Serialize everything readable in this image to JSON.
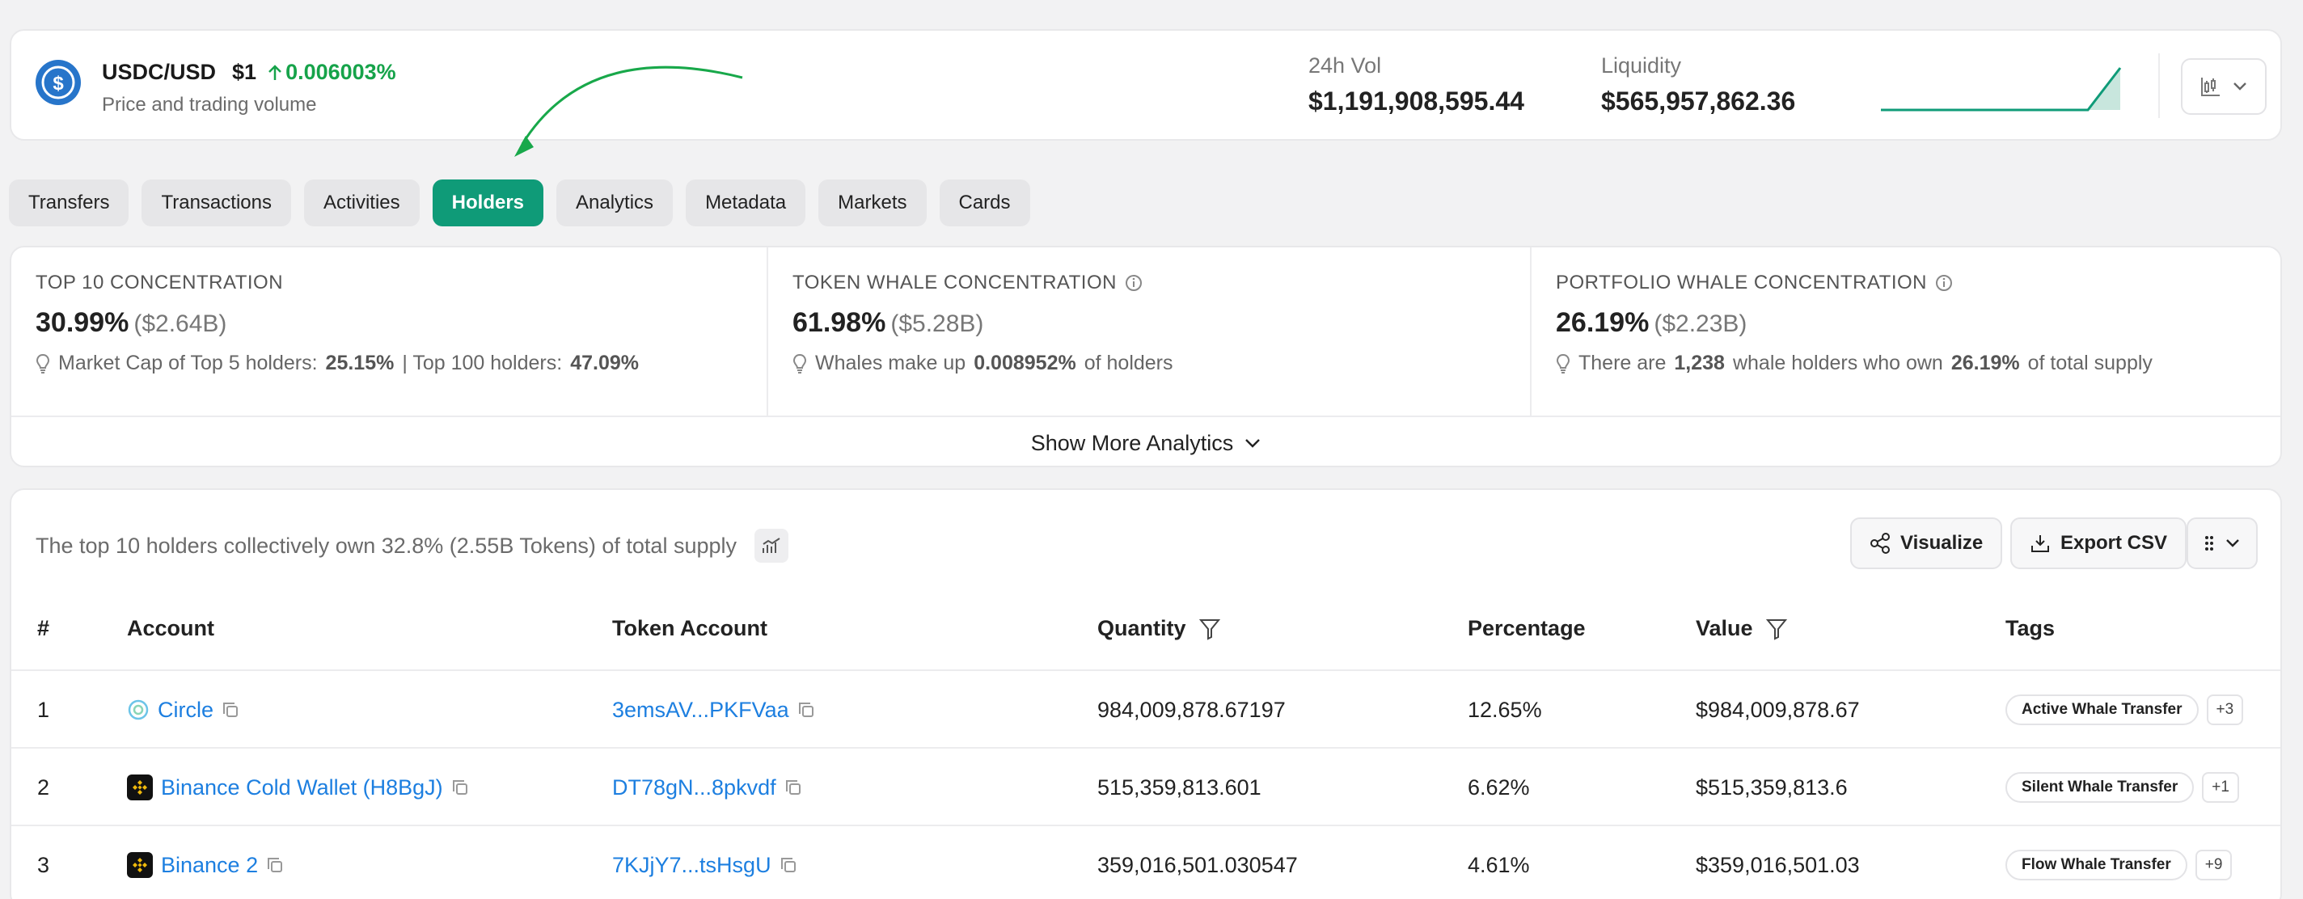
{
  "header": {
    "pair": "USDC/USD",
    "price": "$1",
    "change": "0.006003%",
    "subtitle": "Price and trading volume",
    "vol_label": "24h Vol",
    "vol_value": "$1,191,908,595.44",
    "liq_label": "Liquidity",
    "liq_value": "$565,957,862.36",
    "accent": "#16a34a",
    "coin_color": "#2775ca"
  },
  "tabs": [
    {
      "label": "Transfers"
    },
    {
      "label": "Transactions"
    },
    {
      "label": "Activities"
    },
    {
      "label": "Holders"
    },
    {
      "label": "Analytics"
    },
    {
      "label": "Metadata"
    },
    {
      "label": "Markets"
    },
    {
      "label": "Cards"
    }
  ],
  "active_tab": "Holders",
  "analytics": {
    "top10": {
      "title": "TOP 10 CONCENTRATION",
      "value": "30.99%",
      "sub": "($2.64B)",
      "note_1": "Market Cap of Top 5 holders:",
      "note_2": "25.15%",
      "note_3": "| Top 100 holders:",
      "note_4": "47.09%"
    },
    "token_whale": {
      "title": "TOKEN WHALE CONCENTRATION",
      "value": "61.98%",
      "sub": "($5.28B)",
      "note_1": "Whales make up",
      "note_2": "0.008952%",
      "note_3": "of holders"
    },
    "portfolio_whale": {
      "title": "PORTFOLIO WHALE CONCENTRATION",
      "value": "26.19%",
      "sub": "($2.23B)",
      "note_1": "There are",
      "note_2": "1,238",
      "note_3": "whale holders who own",
      "note_4": "26.19%",
      "note_5": "of total supply"
    },
    "show_more": "Show More Analytics"
  },
  "holders": {
    "summary": "The top 10 holders collectively own 32.8% (2.55B Tokens) of total supply",
    "visualize": "Visualize",
    "export": "Export CSV",
    "columns": [
      "#",
      "Account",
      "Token Account",
      "Quantity",
      "Percentage",
      "Value",
      "Tags"
    ],
    "rows": [
      {
        "rank": "1",
        "account": "Circle",
        "token_account": "3emsAV...PKFVaa",
        "quantity": "984,009,878.67197",
        "percentage": "12.65%",
        "value": "$984,009,878.67",
        "tag": "Active Whale Transfer",
        "more": "+3"
      },
      {
        "rank": "2",
        "account": "Binance Cold Wallet (H8BgJ)",
        "token_account": "DT78gN...8pkvdf",
        "quantity": "515,359,813.601",
        "percentage": "6.62%",
        "value": "$515,359,813.6",
        "tag": "Silent Whale Transfer",
        "more": "+1"
      },
      {
        "rank": "3",
        "account": "Binance 2",
        "token_account": "7KJjY7...tsHsgU",
        "quantity": "359,016,501.030547",
        "percentage": "4.61%",
        "value": "$359,016,501.03",
        "tag": "Flow Whale Transfer",
        "more": "+9"
      }
    ]
  }
}
